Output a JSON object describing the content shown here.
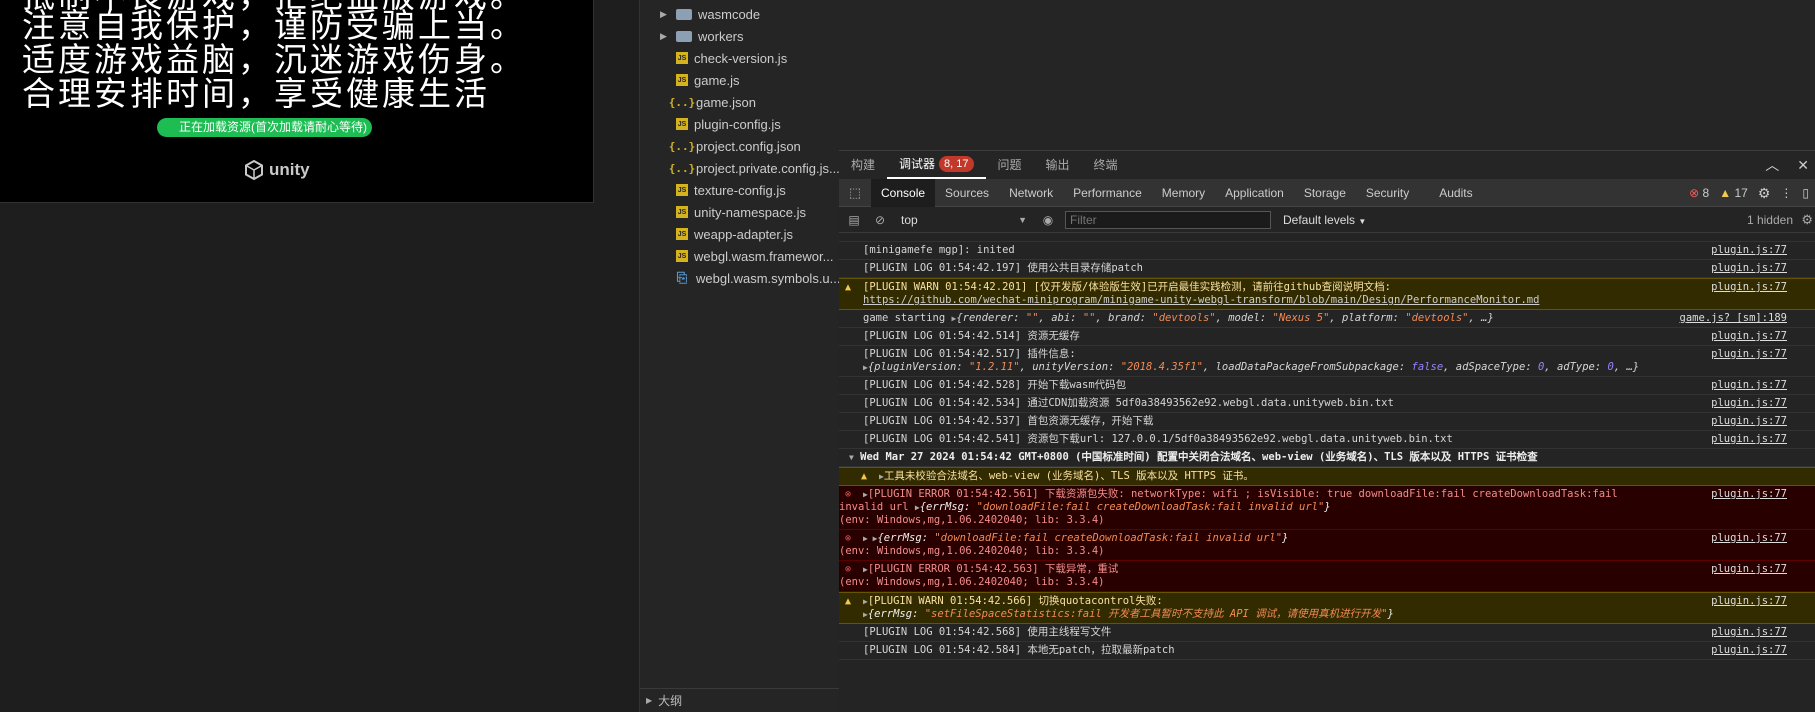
{
  "game": {
    "notice_lines": [
      "注意自我保护，谨防受骗上当。",
      "适度游戏益脑，沉迷游戏伤身。",
      "合理安排时间，享受健康生活"
    ],
    "loading_text": "正在加载资源(首次加载请耐心等待)",
    "logo_text": "unity"
  },
  "files": [
    {
      "name": "wasmcode",
      "type": "folder"
    },
    {
      "name": "workers",
      "type": "folder"
    },
    {
      "name": "check-version.js",
      "type": "js"
    },
    {
      "name": "game.js",
      "type": "js"
    },
    {
      "name": "game.json",
      "type": "json"
    },
    {
      "name": "plugin-config.js",
      "type": "js"
    },
    {
      "name": "project.config.json",
      "type": "json"
    },
    {
      "name": "project.private.config.js...",
      "type": "json"
    },
    {
      "name": "texture-config.js",
      "type": "js"
    },
    {
      "name": "unity-namespace.js",
      "type": "js"
    },
    {
      "name": "weapp-adapter.js",
      "type": "js"
    },
    {
      "name": "webgl.wasm.framewor...",
      "type": "js"
    },
    {
      "name": "webgl.wasm.symbols.u...",
      "type": "sym"
    }
  ],
  "outline_label": "大纲",
  "panel_tabs": {
    "build": "构建",
    "debugger": "调试器",
    "badge": "8, 17",
    "problems": "问题",
    "output": "输出",
    "terminal": "终端"
  },
  "devtools_tabs": [
    "Console",
    "Sources",
    "Network",
    "Performance",
    "Memory",
    "Application",
    "Storage",
    "Security",
    "Audits"
  ],
  "counts": {
    "errors": "8",
    "warnings": "17"
  },
  "toolbar": {
    "context": "top",
    "filter_placeholder": "Filter",
    "levels": "Default levels",
    "hidden": "1 hidden"
  },
  "log": {
    "m1": "[minigamefe mgp]: inited",
    "m1src": "plugin.js:77",
    "m2": "[PLUGIN LOG 01:54:42.197] 使用公共目录存储patch",
    "m3": "[PLUGIN WARN 01:54:42.201] [仅开发版/体验版生效]已开启最佳实践检测，请前往github查阅说明文档:",
    "m3b": "https://github.com/wechat-miniprogram/minigame-unity-webgl-transform/blob/main/Design/PerformanceMonitor.md",
    "m4a": "game starting",
    "m4src": "game.js? [sm]:189",
    "m5": "[PLUGIN LOG 01:54:42.514] 资源无缓存",
    "m6": "[PLUGIN LOG 01:54:42.517] 插件信息:",
    "m7": "[PLUGIN LOG 01:54:42.528] 开始下载wasm代码包",
    "m8": "[PLUGIN LOG 01:54:42.534] 通过CDN加载资源 5df0a38493562e92.webgl.data.unityweb.bin.txt",
    "m9": "[PLUGIN LOG 01:54:42.537] 首包资源无缓存，开始下载",
    "m10": "[PLUGIN LOG 01:54:42.541] 资源包下载url: 127.0.0.1/5df0a38493562e92.webgl.data.unityweb.bin.txt",
    "m11": "Wed Mar 27 2024 01:54:42 GMT+0800 (中国标准时间) 配置中关闭合法域名、web-view (业务域名)、TLS 版本以及 HTTPS 证书检查",
    "m12": "工具未校验合法域名、web-view (业务域名)、TLS 版本以及 HTTPS 证书。",
    "m13a": "[PLUGIN ERROR 01:54:42.561] 下载资源包失败: networkType: wifi ; isVisible: true downloadFile:fail createDownloadTask:fail",
    "m13b": "invalid url",
    "m13c": "\"downloadFile:fail createDownloadTask:fail invalid url\"",
    "env": "(env: Windows,mg,1.06.2402040; lib: 3.3.4)",
    "m15": "[PLUGIN ERROR 01:54:42.563] 下载异常，重试",
    "m16": "[PLUGIN WARN 01:54:42.566] 切换quotacontrol失败:",
    "m16b": "\"setFileSpaceStatistics:fail 开发者工具暂时不支持此 API 调试，请使用真机进行开发\"",
    "m17": "[PLUGIN LOG 01:54:42.568] 使用主线程写文件",
    "m18": "[PLUGIN LOG 01:54:42.584] 本地无patch，拉取最新patch"
  },
  "colors": {
    "loading_bar": "#1dbd53",
    "error_bg": "#290000",
    "warn_bg": "#332b00"
  }
}
